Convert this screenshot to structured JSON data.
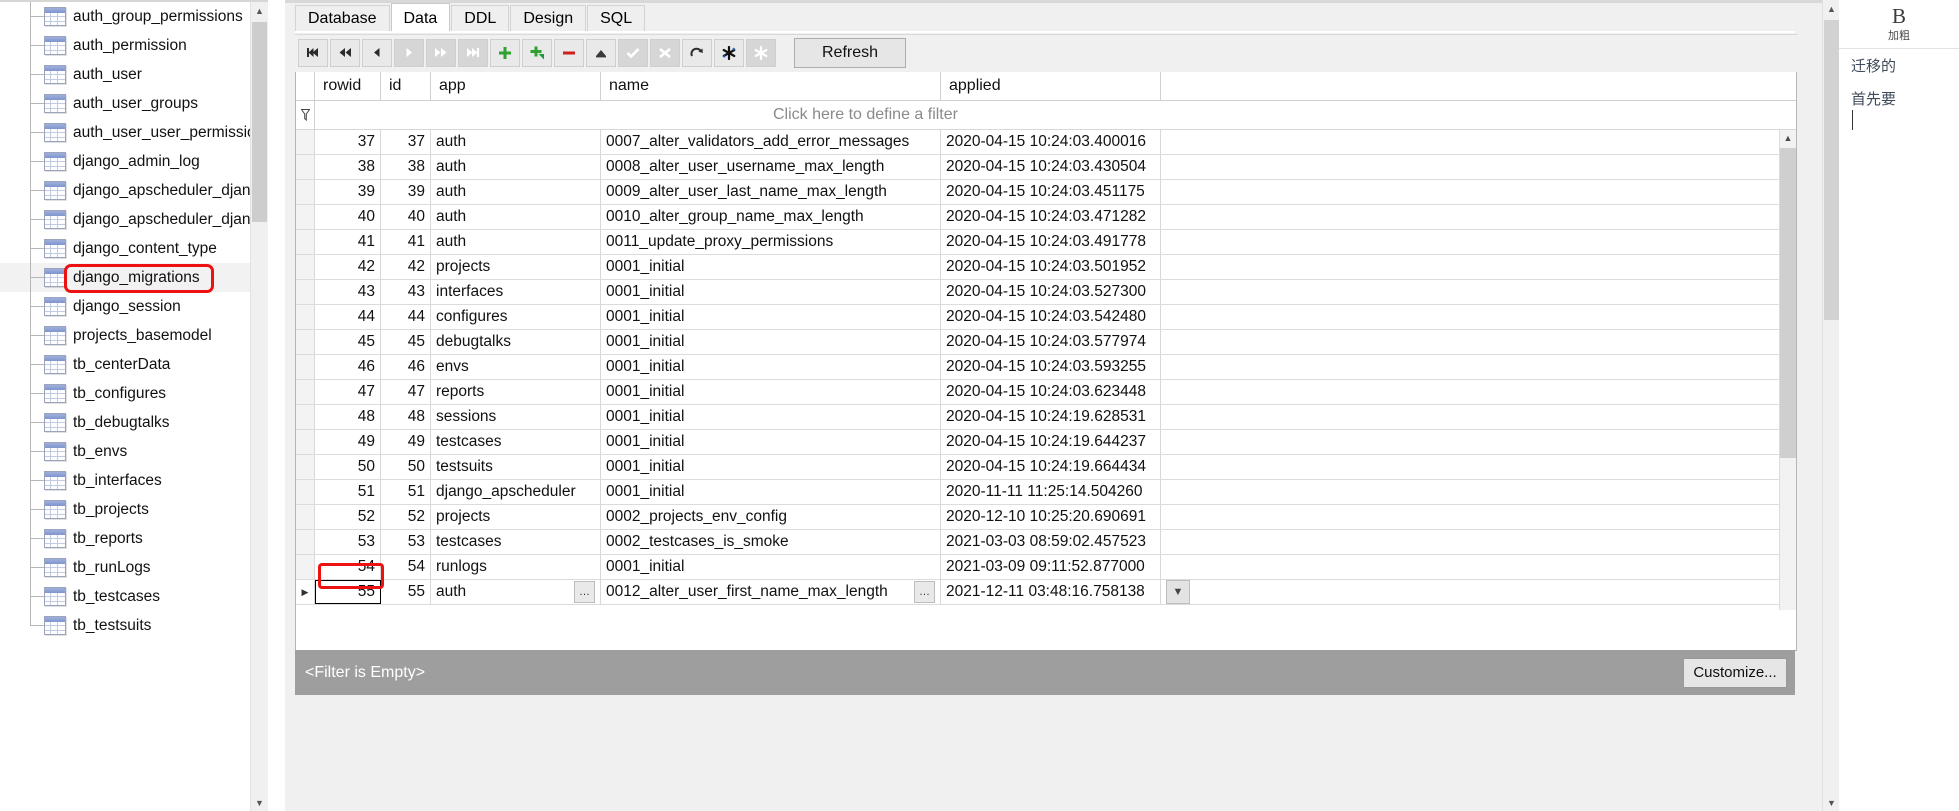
{
  "sidebar": {
    "name": "database-table-tree",
    "scroll": {
      "up_icon": "chevron-up-icon",
      "down_icon": "chevron-down-icon"
    },
    "items": [
      {
        "label": "auth_group_permissions",
        "selected": false
      },
      {
        "label": "auth_permission",
        "selected": false
      },
      {
        "label": "auth_user",
        "selected": false
      },
      {
        "label": "auth_user_groups",
        "selected": false
      },
      {
        "label": "auth_user_user_permissions",
        "selected": false
      },
      {
        "label": "django_admin_log",
        "selected": false
      },
      {
        "label": "django_apscheduler_django",
        "selected": false
      },
      {
        "label": "django_apscheduler_django",
        "selected": false
      },
      {
        "label": "django_content_type",
        "selected": false
      },
      {
        "label": "django_migrations",
        "selected": true
      },
      {
        "label": "django_session",
        "selected": false
      },
      {
        "label": "projects_basemodel",
        "selected": false
      },
      {
        "label": "tb_centerData",
        "selected": false
      },
      {
        "label": "tb_configures",
        "selected": false
      },
      {
        "label": "tb_debugtalks",
        "selected": false
      },
      {
        "label": "tb_envs",
        "selected": false
      },
      {
        "label": "tb_interfaces",
        "selected": false
      },
      {
        "label": "tb_projects",
        "selected": false
      },
      {
        "label": "tb_reports",
        "selected": false
      },
      {
        "label": "tb_runLogs",
        "selected": false
      },
      {
        "label": "tb_testcases",
        "selected": false
      },
      {
        "label": "tb_testsuits",
        "selected": false
      }
    ]
  },
  "tabs": [
    {
      "label": "Database",
      "active": false
    },
    {
      "label": "Data",
      "active": true
    },
    {
      "label": "DDL",
      "active": false
    },
    {
      "label": "Design",
      "active": false
    },
    {
      "label": "SQL",
      "active": false
    }
  ],
  "toolbar": {
    "refresh_label": "Refresh",
    "buttons": [
      {
        "name": "first-record-button",
        "icon": "skip-to-start-icon",
        "disabled": false
      },
      {
        "name": "prev-page-button",
        "icon": "rewind-icon",
        "disabled": false
      },
      {
        "name": "prev-record-button",
        "icon": "step-back-icon",
        "disabled": false
      },
      {
        "name": "next-record-button",
        "icon": "step-forward-icon",
        "disabled": true
      },
      {
        "name": "next-page-button",
        "icon": "fast-forward-icon",
        "disabled": true
      },
      {
        "name": "last-record-button",
        "icon": "skip-to-end-icon",
        "disabled": true
      },
      {
        "name": "insert-record-button",
        "icon": "plus-icon",
        "disabled": false
      },
      {
        "name": "duplicate-record-button",
        "icon": "plus-copy-icon",
        "disabled": false
      },
      {
        "name": "delete-record-button",
        "icon": "minus-icon",
        "disabled": false
      },
      {
        "name": "export-button",
        "icon": "upload-icon",
        "disabled": false
      },
      {
        "name": "commit-button",
        "icon": "check-icon",
        "disabled": true
      },
      {
        "name": "rollback-button",
        "icon": "cross-icon",
        "disabled": true
      },
      {
        "name": "refresh-record-button",
        "icon": "redo-arrow-icon",
        "disabled": false
      },
      {
        "name": "set-null-button",
        "icon": "asterisk-icon",
        "disabled": false
      },
      {
        "name": "clear-null-button",
        "icon": "asterisk-dim-icon",
        "disabled": true
      }
    ]
  },
  "grid": {
    "columns": [
      "rowid",
      "id",
      "app",
      "name",
      "applied"
    ],
    "filter_hint": "Click here to define a filter",
    "funnel_icon": "filter-funnel-icon",
    "rows": [
      {
        "rowid": "37",
        "id": "37",
        "app": "auth",
        "name": "0007_alter_validators_add_error_messages",
        "applied": "2020-04-15 10:24:03.400016"
      },
      {
        "rowid": "38",
        "id": "38",
        "app": "auth",
        "name": "0008_alter_user_username_max_length",
        "applied": "2020-04-15 10:24:03.430504"
      },
      {
        "rowid": "39",
        "id": "39",
        "app": "auth",
        "name": "0009_alter_user_last_name_max_length",
        "applied": "2020-04-15 10:24:03.451175"
      },
      {
        "rowid": "40",
        "id": "40",
        "app": "auth",
        "name": "0010_alter_group_name_max_length",
        "applied": "2020-04-15 10:24:03.471282"
      },
      {
        "rowid": "41",
        "id": "41",
        "app": "auth",
        "name": "0011_update_proxy_permissions",
        "applied": "2020-04-15 10:24:03.491778"
      },
      {
        "rowid": "42",
        "id": "42",
        "app": "projects",
        "name": "0001_initial",
        "applied": "2020-04-15 10:24:03.501952"
      },
      {
        "rowid": "43",
        "id": "43",
        "app": "interfaces",
        "name": "0001_initial",
        "applied": "2020-04-15 10:24:03.527300"
      },
      {
        "rowid": "44",
        "id": "44",
        "app": "configures",
        "name": "0001_initial",
        "applied": "2020-04-15 10:24:03.542480"
      },
      {
        "rowid": "45",
        "id": "45",
        "app": "debugtalks",
        "name": "0001_initial",
        "applied": "2020-04-15 10:24:03.577974"
      },
      {
        "rowid": "46",
        "id": "46",
        "app": "envs",
        "name": "0001_initial",
        "applied": "2020-04-15 10:24:03.593255"
      },
      {
        "rowid": "47",
        "id": "47",
        "app": "reports",
        "name": "0001_initial",
        "applied": "2020-04-15 10:24:03.623448"
      },
      {
        "rowid": "48",
        "id": "48",
        "app": "sessions",
        "name": "0001_initial",
        "applied": "2020-04-15 10:24:19.628531"
      },
      {
        "rowid": "49",
        "id": "49",
        "app": "testcases",
        "name": "0001_initial",
        "applied": "2020-04-15 10:24:19.644237"
      },
      {
        "rowid": "50",
        "id": "50",
        "app": "testsuits",
        "name": "0001_initial",
        "applied": "2020-04-15 10:24:19.664434"
      },
      {
        "rowid": "51",
        "id": "51",
        "app": "django_apscheduler",
        "name": "0001_initial",
        "applied": "2020-11-11 11:25:14.504260"
      },
      {
        "rowid": "52",
        "id": "52",
        "app": "projects",
        "name": "0002_projects_env_config",
        "applied": "2020-12-10 10:25:20.690691"
      },
      {
        "rowid": "53",
        "id": "53",
        "app": "testcases",
        "name": "0002_testcases_is_smoke",
        "applied": "2021-03-03 08:59:02.457523"
      },
      {
        "rowid": "54",
        "id": "54",
        "app": "runlogs",
        "name": "0001_initial",
        "applied": "2021-03-09 09:11:52.877000"
      }
    ],
    "current_row": {
      "marker_icon": "row-pointer-icon",
      "rowid": "55",
      "id": "55",
      "app": "auth",
      "app_ellipsis": "…",
      "name": "0012_alter_user_first_name_max_length",
      "name_ellipsis": "…",
      "applied": "2021-12-11 03:48:16.758138",
      "dropdown_icon": "chevron-down-icon"
    },
    "scroll": {
      "up_icon": "chevron-up-icon",
      "down_icon": "chevron-down-icon"
    }
  },
  "statusbar": {
    "filter_text": "<Filter is Empty>",
    "customize_label": "Customize..."
  },
  "outer_scroll": {
    "up_icon": "chevron-up-icon",
    "down_icon": "chevron-down-icon"
  },
  "side_panel": {
    "bold_glyph": "B",
    "bold_label": "加粗",
    "line1": "迁移的",
    "line2": "首先要"
  },
  "colors": {
    "highlight_red": "#ee1111",
    "status_gray": "#9e9e9e",
    "accent_green": "#2ea12e"
  }
}
